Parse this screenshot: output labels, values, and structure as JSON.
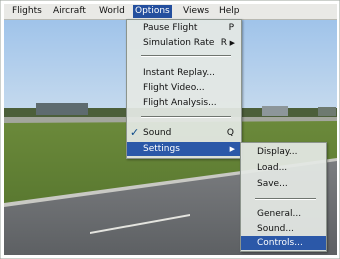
{
  "menubar": {
    "items": [
      "Flights",
      "Aircraft",
      "World",
      "Options",
      "Views",
      "Help"
    ],
    "active": "Options"
  },
  "options_menu": {
    "items": [
      {
        "label": "Pause Flight",
        "shortcut": "P"
      },
      {
        "label": "Simulation Rate",
        "shortcut": "R",
        "submenu": true
      },
      {
        "label": "Instant Replay..."
      },
      {
        "label": "Flight Video..."
      },
      {
        "label": "Flight Analysis..."
      },
      {
        "label": "Sound",
        "shortcut": "Q",
        "checked": true
      },
      {
        "label": "Settings",
        "submenu": true,
        "selected": true
      }
    ]
  },
  "settings_menu": {
    "items": [
      {
        "label": "Display..."
      },
      {
        "label": "Load..."
      },
      {
        "label": "Save..."
      },
      {
        "label": "General..."
      },
      {
        "label": "Sound..."
      },
      {
        "label": "Controls...",
        "selected": true
      }
    ]
  },
  "icons": {
    "check": "checkmark-icon",
    "submenu": "right-arrow-icon"
  },
  "colors": {
    "highlight": "#2b58a8",
    "menubar": "#e9e9e6"
  }
}
